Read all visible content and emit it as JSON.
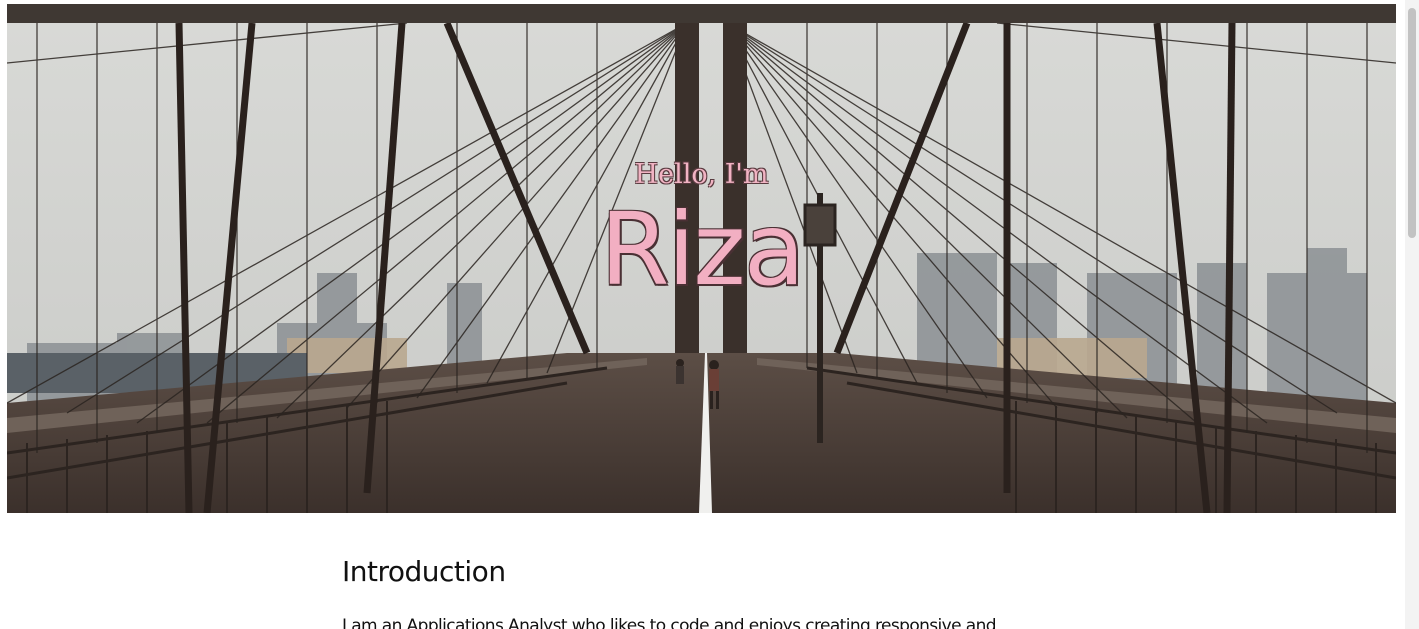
{
  "hero": {
    "greeting": "Hello, I'm",
    "name": "Riza"
  },
  "intro": {
    "heading": "Introduction",
    "text": "I am an Applications Analyst who likes to code and enjoys creating responsive and"
  },
  "colors": {
    "accent_pink": "#f2afc2",
    "hero_dark": "#3f3833",
    "heading_text": "#111111"
  },
  "scrollbar": {
    "icon": "vertical-scrollbar"
  }
}
